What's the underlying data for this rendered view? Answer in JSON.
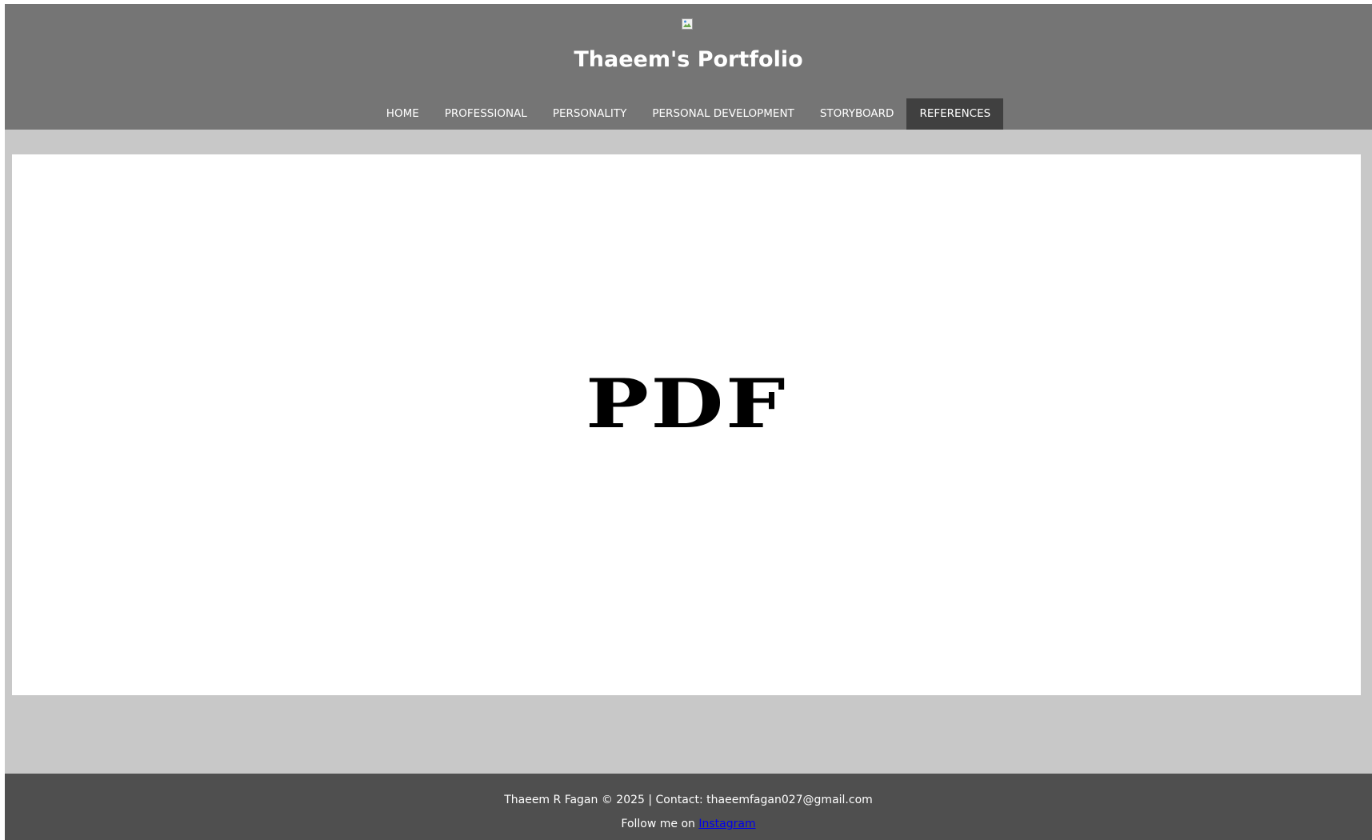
{
  "header": {
    "title": "Thaeem's Portfolio",
    "logo_icon": "broken-image-icon"
  },
  "nav": {
    "items": [
      {
        "label": "HOME",
        "active": false
      },
      {
        "label": "PROFESSIONAL",
        "active": false
      },
      {
        "label": "PERSONALITY",
        "active": false
      },
      {
        "label": "PERSONAL DEVELOPMENT",
        "active": false
      },
      {
        "label": "STORYBOARD",
        "active": false
      },
      {
        "label": "REFERENCES",
        "active": true
      }
    ]
  },
  "main": {
    "embed_label": "PDF"
  },
  "footer": {
    "copyright": "Thaeem R Fagan © 2025 | Contact: thaeemfagan027@gmail.com",
    "follow_text": "Follow me on",
    "instagram_link": "Instagram"
  },
  "colors": {
    "header_bg": "#757575",
    "nav_active_bg": "#404040",
    "page_bg": "#c8c8c8",
    "footer_bg": "#4f4f4f",
    "link": "#0000ee"
  }
}
